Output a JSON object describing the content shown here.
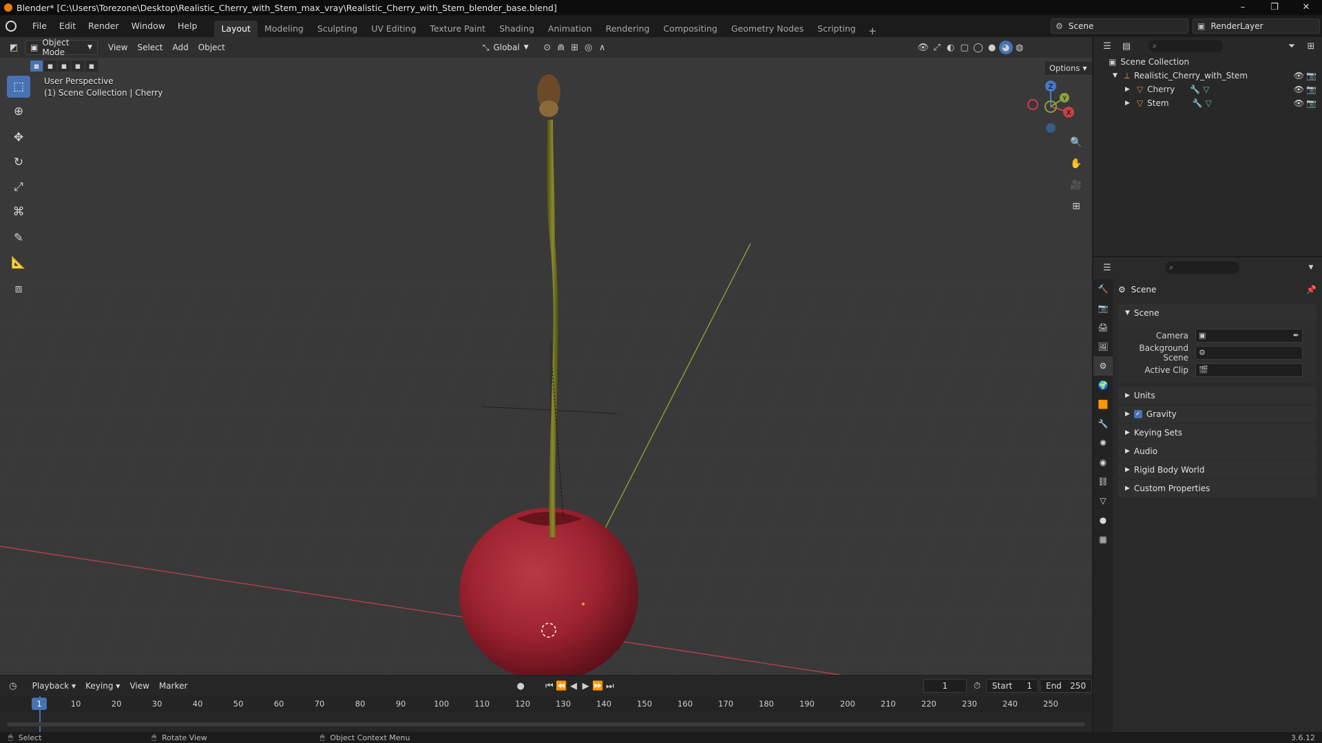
{
  "window": {
    "title": "Blender* [C:\\Users\\Torezone\\Desktop\\Realistic_Cherry_with_Stem_max_vray\\Realistic_Cherry_with_Stem_blender_base.blend]",
    "minimize": "–",
    "maximize": "❐",
    "close": "✕"
  },
  "menu": {
    "items": [
      "File",
      "Edit",
      "Render",
      "Window",
      "Help"
    ],
    "workspaces": [
      "Layout",
      "Modeling",
      "Sculpting",
      "UV Editing",
      "Texture Paint",
      "Shading",
      "Animation",
      "Rendering",
      "Compositing",
      "Geometry Nodes",
      "Scripting"
    ],
    "active_workspace": "Layout",
    "add_tab": "+",
    "scene_name": "Scene",
    "view_layer": "RenderLayer"
  },
  "viewport": {
    "mode": "Object Mode",
    "header_menus": [
      "View",
      "Select",
      "Add",
      "Object"
    ],
    "orientation": "Global",
    "options_label": "Options",
    "info_line1": "User Perspective",
    "info_line2": "(1) Scene Collection | Cherry",
    "gizmo_axes": {
      "x": "X",
      "y": "Y",
      "z": "Z"
    },
    "colors": {
      "background": "#393939",
      "x_axis": "#b5404a",
      "y_axis": "#8aa33a",
      "cherry": "#9e2330",
      "stem": "#6e6b1e",
      "accent": "#4772b3"
    }
  },
  "outliner": {
    "root": "Scene Collection",
    "collection": "Realistic_Cherry_with_Stem",
    "objects": [
      "Cherry",
      "Stem"
    ]
  },
  "properties": {
    "context_title": "Scene",
    "panel_scene": "Scene",
    "camera_label": "Camera",
    "background_scene_label": "Background Scene",
    "active_clip_label": "Active Clip",
    "panels": [
      "Units",
      "Gravity",
      "Keying Sets",
      "Audio",
      "Rigid Body World",
      "Custom Properties"
    ],
    "gravity_checked": true
  },
  "timeline": {
    "menus": [
      "Playback",
      "Keying",
      "View",
      "Marker"
    ],
    "current_frame": "1",
    "start_label": "Start",
    "start_value": "1",
    "end_label": "End",
    "end_value": "250",
    "ruler_labels": [
      "1",
      "10",
      "20",
      "30",
      "40",
      "50",
      "60",
      "70",
      "80",
      "90",
      "100",
      "110",
      "120",
      "130",
      "140",
      "150",
      "160",
      "170",
      "180",
      "190",
      "200",
      "210",
      "220",
      "230",
      "240",
      "250"
    ]
  },
  "statusbar": {
    "select": "Select",
    "rotate": "Rotate View",
    "context_menu": "Object Context Menu",
    "version": "3.6.12"
  }
}
